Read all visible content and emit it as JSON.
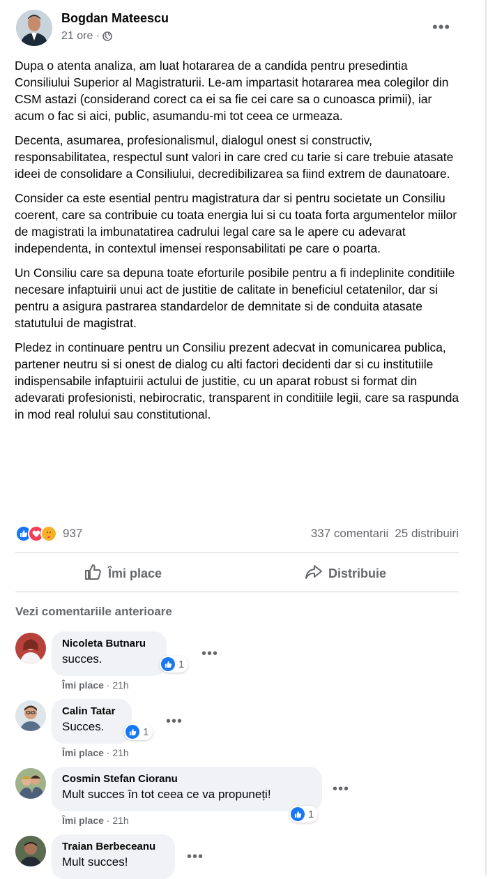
{
  "post": {
    "author": "Bogdan Mateescu",
    "time": "21 ore ·",
    "paragraphs": [
      "Dupa o atenta analiza, am luat hotararea de a candida pentru presedintia Consiliului Superior al Magistraturii. Le-am impartasit hotararea mea colegilor din CSM astazi (considerand corect  ca ei sa fie cei care sa o cunoasca primii), iar acum o fac si aici, public, asumandu-mi tot ceea ce urmeaza.",
      "Decenta, asumarea, profesionalismul, dialogul onest si constructiv, responsabilitatea,  respectul sunt valori in care cred cu tarie si care trebuie atasate ideei de consolidare a Consiliului, decredibilizarea sa fiind extrem de daunatoare.",
      "Consider ca este esential pentru magistratura dar si pentru societate un Consiliu coerent, care sa contribuie cu toata energia lui si cu toata forta argumentelor miilor de magistrati la imbunatatirea cadrului legal care sa le apere cu adevarat independenta, in contextul imensei responsabilitati pe care o poarta.",
      "Un Consiliu care sa depuna toate eforturile posibile pentru a fi indeplinite conditiile necesare infaptuirii unui act de justitie de calitate in beneficiul cetatenilor, dar si pentru a asigura pastrarea standardelor de demnitate si de conduita atasate statutului de magistrat.",
      "Pledez in continuare pentru un Consiliu prezent adecvat in comunicarea publica, partener neutru si si onest de dialog cu alti factori decidenti dar si cu institutiile indispensabile infaptuirii actului de justitie, cu un aparat robust si format din adevarati profesionisti, nebirocratic, transparent in conditiile legii, care sa raspunda in mod real rolului sau constitutional."
    ],
    "reaction_count": "937",
    "comments_count": "337 comentarii",
    "shares_count": "25 distribuiri"
  },
  "actions": {
    "like": "Îmi place",
    "share": "Distribuie"
  },
  "prev_comments_label": "Vezi comentariile anterioare",
  "comments": [
    {
      "name": "Nicoleta Butnaru",
      "text": "succes.",
      "likes": "1",
      "like_label": "Îmi place",
      "time": " · 21h"
    },
    {
      "name": "Calin Tatar",
      "text": "Succes.",
      "likes": "1",
      "like_label": "Îmi place",
      "time": " · 21h"
    },
    {
      "name": "Cosmin Stefan Cioranu",
      "text": "Mult succes în tot ceea ce va propuneți!",
      "likes": "1",
      "like_label": "Îmi place",
      "time": " · 21h"
    },
    {
      "name": "Traian Berbeceanu",
      "text": "Mult succes!"
    }
  ],
  "colors": {
    "like_blue": "#1877f2",
    "love_red": "#f33e58",
    "care_yellow": "#f7b125",
    "secondary_text": "#65676b",
    "bubble_bg": "#f0f2f5"
  },
  "icons": {
    "globe": "globe-icon",
    "more": "more-icon",
    "like": "thumbs-up-icon",
    "share": "share-arrow-icon"
  }
}
